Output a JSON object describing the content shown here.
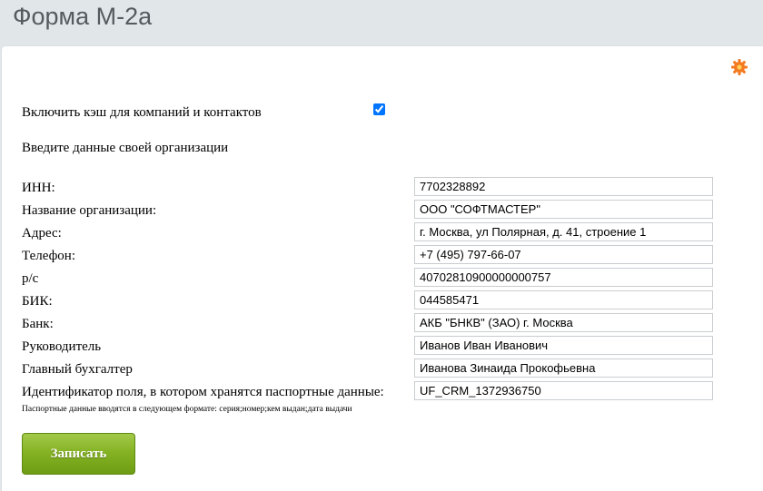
{
  "page": {
    "title": "Форма М-2а"
  },
  "settings": {
    "icon": "gear-icon",
    "icon_color": "#f47a20"
  },
  "cache": {
    "label": "Включить кэш для компаний и контактов",
    "checked": true
  },
  "section": {
    "heading": "Введите данные своей организации"
  },
  "fields": [
    {
      "label": "ИНН:",
      "value": "7702328892"
    },
    {
      "label": "Название организации:",
      "value": "ООО \"СОФТМАСТЕР\""
    },
    {
      "label": "Адрес:",
      "value": "г. Москва, ул Полярная, д. 41, строение 1"
    },
    {
      "label": "Телефон:",
      "value": "+7 (495) 797-66-07"
    },
    {
      "label": "р/с",
      "value": "40702810900000000757"
    },
    {
      "label": "БИК:",
      "value": "044585471"
    },
    {
      "label": "Банк:",
      "value": "АКБ \"БНКВ\" (ЗАО) г. Москва"
    },
    {
      "label": "Руководитель",
      "value": "Иванов Иван Иванович"
    },
    {
      "label": "Главный бухгалтер",
      "value": "Иванова Зинаида Прокофьевна"
    },
    {
      "label": "Идентификатор поля, в котором хранятся паспортные данные:",
      "value": "UF_CRM_1372936750"
    }
  ],
  "hint": "Паспортные данные вводятся в следующем формате: серия;номер;кем выдан;дата выдачи",
  "actions": {
    "save_label": "Записать",
    "save_color": "#7aa81c"
  }
}
